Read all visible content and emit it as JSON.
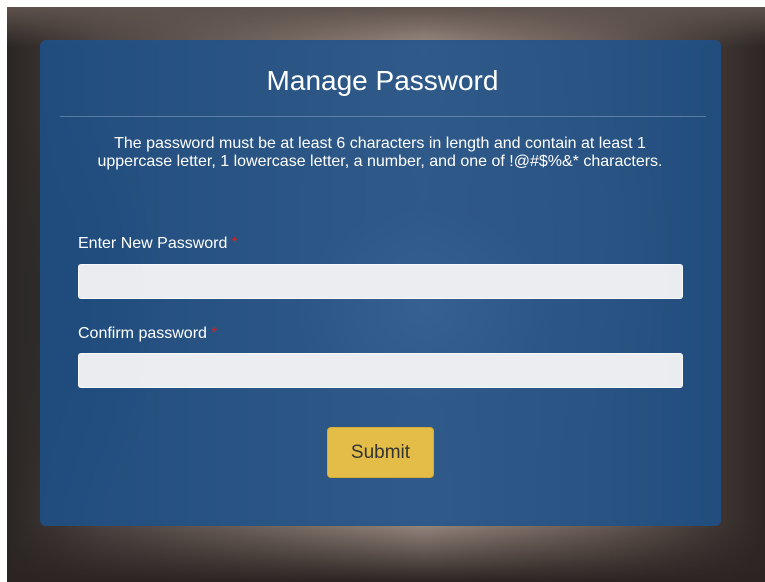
{
  "form": {
    "title": "Manage Password",
    "rules_text": "The password must be at least 6 characters in length and contain at least 1 uppercase letter, 1 lowercase letter, a number, and one of !@#$%&* characters.",
    "new_password": {
      "label": "Enter New Password",
      "required_marker": "*",
      "value": "",
      "placeholder": ""
    },
    "confirm_password": {
      "label": "Confirm password",
      "required_marker": "*",
      "value": "",
      "placeholder": ""
    },
    "submit_label": "Submit"
  },
  "colors": {
    "panel": "#1d528a",
    "submit_button": "#e3bd48",
    "required_marker": "#c62828",
    "text": "#ffffff"
  }
}
